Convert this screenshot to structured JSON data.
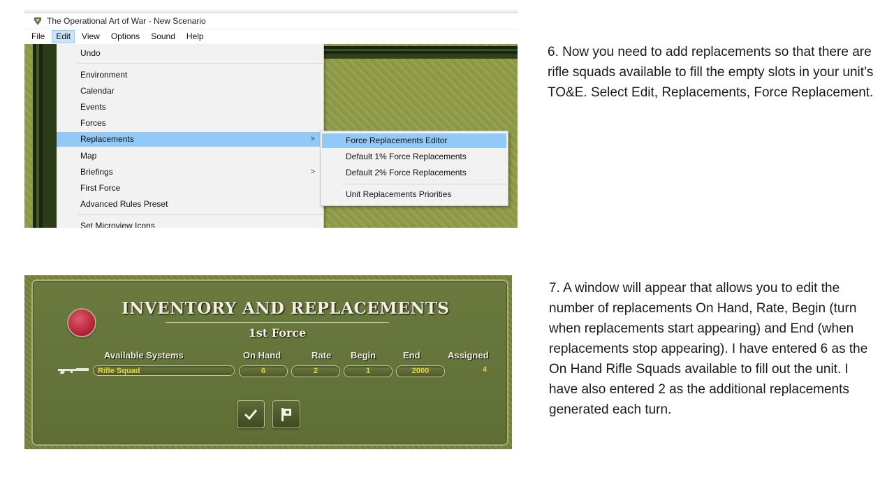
{
  "menu_screenshot": {
    "window_title": "The Operational Art of War - New Scenario",
    "menubar": [
      "File",
      "Edit",
      "View",
      "Options",
      "Sound",
      "Help"
    ],
    "active_menu": "Edit",
    "edit_menu_items": [
      {
        "label": "Undo"
      },
      {
        "label": "Environment"
      },
      {
        "label": "Calendar"
      },
      {
        "label": "Events"
      },
      {
        "label": "Forces"
      },
      {
        "label": "Replacements",
        "submenu_arrow": ">",
        "highlighted": true
      },
      {
        "label": "Map"
      },
      {
        "label": "Briefings",
        "submenu_arrow": ">"
      },
      {
        "label": "First Force"
      },
      {
        "label": "Advanced Rules Preset"
      },
      {
        "label": "Set Microview Icons"
      }
    ],
    "replacements_submenu": [
      {
        "label": "Force Replacements Editor",
        "highlighted": true
      },
      {
        "label": "Default 1% Force Replacements"
      },
      {
        "label": "Default 2% Force Replacements"
      },
      {
        "label": "Unit Replacements Priorities"
      }
    ]
  },
  "inventory_screenshot": {
    "title": "INVENTORY AND REPLACEMENTS",
    "force_name": "1st Force",
    "columns": {
      "available_systems": "Available Systems",
      "on_hand": "On Hand",
      "rate": "Rate",
      "begin": "Begin",
      "end": "End",
      "assigned": "Assigned"
    },
    "rows": [
      {
        "system": "Rifle Squad",
        "on_hand": "6",
        "rate": "2",
        "begin": "1",
        "end": "2000",
        "assigned": "4",
        "icon": "rifle-icon"
      }
    ],
    "buttons": [
      "ok-check-button",
      "flag-button"
    ]
  },
  "instructions": {
    "step6": "6.  Now you need to add replacements so that there are rifle squads available to fill the empty slots in your unit’s TO&E. Select Edit, Replacements, Force Replacement.",
    "step7": "7.  A window will appear that allows you to edit the number of replacements On Hand, Rate, Begin (turn when replacements start appearing) and End (when replacements stop appearing).  I have entered 6 as the On Hand Rifle Squads available to fill out the unit.  I have also entered 2 as the additional replacements generated each turn."
  },
  "colors": {
    "menu_highlight": "#91c9f7",
    "panel_green": "#6b7a3f",
    "value_yellow": "#e6d23a",
    "red_button": "#b01d34"
  }
}
